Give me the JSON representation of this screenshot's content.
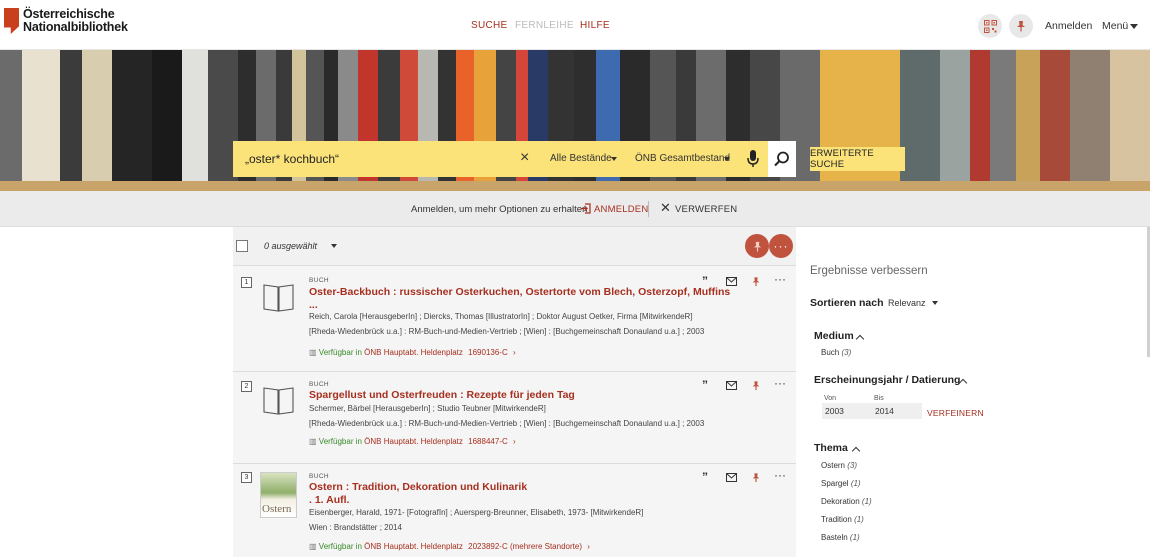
{
  "header": {
    "logo_line1": "Österreichische",
    "logo_line2": "Nationalbibliothek",
    "nav": {
      "suche": "SUCHE",
      "fernleihe": "FERNLEIHE",
      "hilfe": "HILFE"
    },
    "anmelden": "Anmelden",
    "menu": "Menü"
  },
  "search": {
    "query": "„oster* kochbuch“",
    "scope1": "Alle Bestände",
    "scope2": "ÖNB Gesamtbestand",
    "advanced": "ERWEITERTE SUCHE"
  },
  "banner": {
    "text": "Anmelden, um mehr Optionen zu erhalten",
    "login": "ANMELDEN",
    "dismiss": "VERWERFEN"
  },
  "results_toolbar": {
    "selected": "0 ausgewählt"
  },
  "results": [
    {
      "num": "1",
      "type": "BUCH",
      "title1": "Oster-Backbuch : russischer Osterkuchen, Ostertorte vom Blech, Osterzopf, Muffins",
      "title2": "...",
      "line1": "Reich, Carola [HerausgeberIn] ; Diercks, Thomas [IllustratorIn] ; Doktor August Oetker, Firma [MitwirkendeR]",
      "line2": "[Rheda-Wiedenbrück u.a.] : RM-Buch-und-Medien-Vertrieb ; [Wien] : [Buchgemeinschaft Donauland u.a.] ; 2003",
      "avail": "Verfügbar in",
      "location": "ÖNB Hauptabt. Heldenplatz",
      "signature": "1690136-C"
    },
    {
      "num": "2",
      "type": "BUCH",
      "title1": "Spargellust und Osterfreuden : Rezepte für jeden Tag",
      "line1": "Schermer, Bärbel [HerausgeberIn] ; Studio Teubner [MitwirkendeR]",
      "line2": "[Rheda-Wiedenbrück u.a.] : RM-Buch-und-Medien-Vertrieb ; [Wien] : [Buchgemeinschaft Donauland u.a.] ; 2003",
      "avail": "Verfügbar in",
      "location": "ÖNB Hauptabt. Heldenplatz",
      "signature": "1688447-C"
    },
    {
      "num": "3",
      "type": "BUCH",
      "title1": "Ostern : Tradition, Dekoration und Kulinarik",
      "title2": ". 1. Aufl.",
      "line1": "Eisenberger, Harald, 1971- [FotografIn] ; Auersperg-Breunner, Elisabeth, 1973- [MitwirkendeR]",
      "line2": "Wien : Brandstätter ; 2014",
      "avail": "Verfügbar in",
      "location": "ÖNB Hauptabt. Heldenplatz",
      "signature": "2023892-C (mehrere Standorte)",
      "cover_word": "Ostern"
    }
  ],
  "refine": {
    "title": "Ergebnisse verbessern",
    "sort_label": "Sortieren nach",
    "sort_value": "Relevanz",
    "medium": {
      "heading": "Medium",
      "items": [
        {
          "label": "Buch",
          "count": "(3)"
        }
      ]
    },
    "year": {
      "heading": "Erscheinungsjahr / Datierung",
      "from_label": "Von",
      "to_label": "Bis",
      "from": "2003",
      "to": "2014",
      "action": "VERFEINERN"
    },
    "thema": {
      "heading": "Thema",
      "items": [
        {
          "label": "Ostern",
          "count": "(3)"
        },
        {
          "label": "Spargel",
          "count": "(1)"
        },
        {
          "label": "Dekoration",
          "count": "(1)"
        },
        {
          "label": "Tradition",
          "count": "(1)"
        },
        {
          "label": "Basteln",
          "count": "(1)"
        }
      ]
    }
  },
  "colors": {
    "accent": "#a62f1f",
    "search_yellow": "#fbe37a",
    "available_green": "#3a8a2a",
    "logo_red": "#c8401e"
  }
}
